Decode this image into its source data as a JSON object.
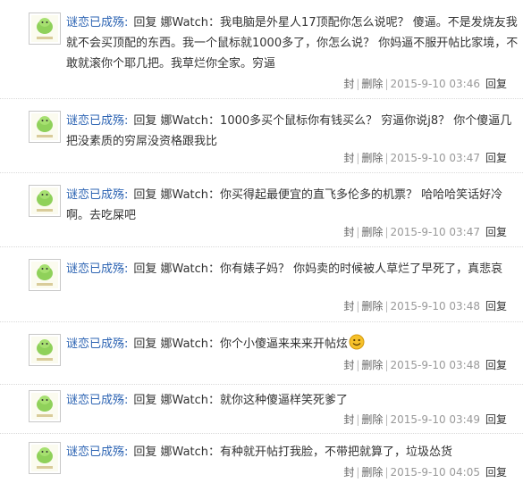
{
  "replies": [
    {
      "user": "谜恋已成殇:",
      "reply_word": "回复",
      "target": "娜Watch",
      "sep": "：",
      "content": "我电脑是外星人17顶配你怎么说呢？ 傻逼。不是发烧友我就不会买顶配的东西。我一个鼠标就1000多了，你怎么说？ 你妈逼不服开帖比家境，不敢就滚你个耶几把。我草烂你全家。穷逼",
      "ban": "封",
      "delete": "删除",
      "time": "2015-9-10 03:46",
      "reply": "回复"
    },
    {
      "user": "谜恋已成殇:",
      "reply_word": "回复",
      "target": "娜Watch",
      "sep": "：",
      "content": "1000多买个鼠标你有钱买么？ 穷逼你说j8？ 你个傻逼几把没素质的穷屌没资格跟我比",
      "ban": "封",
      "delete": "删除",
      "time": "2015-9-10 03:47",
      "reply": "回复"
    },
    {
      "user": "谜恋已成殇:",
      "reply_word": "回复",
      "target": "娜Watch",
      "sep": "：",
      "content": "你买得起最便宜的直飞多伦多的机票？ 哈哈哈笑话好冷啊。去吃屎吧",
      "ban": "封",
      "delete": "删除",
      "time": "2015-9-10 03:47",
      "reply": "回复"
    },
    {
      "user": "谜恋已成殇:",
      "reply_word": "回复",
      "target": "娜Watch",
      "sep": "：",
      "content": "你有婊子妈？ 你妈卖的时候被人草烂了早死了，真悲哀",
      "ban": "封",
      "delete": "删除",
      "time": "2015-9-10 03:48",
      "reply": "回复"
    },
    {
      "user": "谜恋已成殇:",
      "reply_word": "回复",
      "target": "娜Watch",
      "sep": "：",
      "content": "你个小傻逼来来来开帖炫",
      "ban": "封",
      "delete": "删除",
      "time": "2015-9-10 03:48",
      "reply": "回复"
    },
    {
      "user": "谜恋已成殇:",
      "reply_word": "回复",
      "target": "娜Watch",
      "sep": "：",
      "content": "就你这种傻逼样笑死爹了",
      "ban": "封",
      "delete": "删除",
      "time": "2015-9-10 03:49",
      "reply": "回复"
    },
    {
      "user": "谜恋已成殇:",
      "reply_word": "回复",
      "target": "娜Watch",
      "sep": "：",
      "content": "有种就开帖打我脸，不带把就算了，垃圾怂货",
      "ban": "封",
      "delete": "删除",
      "time": "2015-9-10 04:05",
      "reply": "回复"
    }
  ],
  "colors": {
    "username": "#2d64b3",
    "meta": "#999999",
    "text": "#333333"
  }
}
